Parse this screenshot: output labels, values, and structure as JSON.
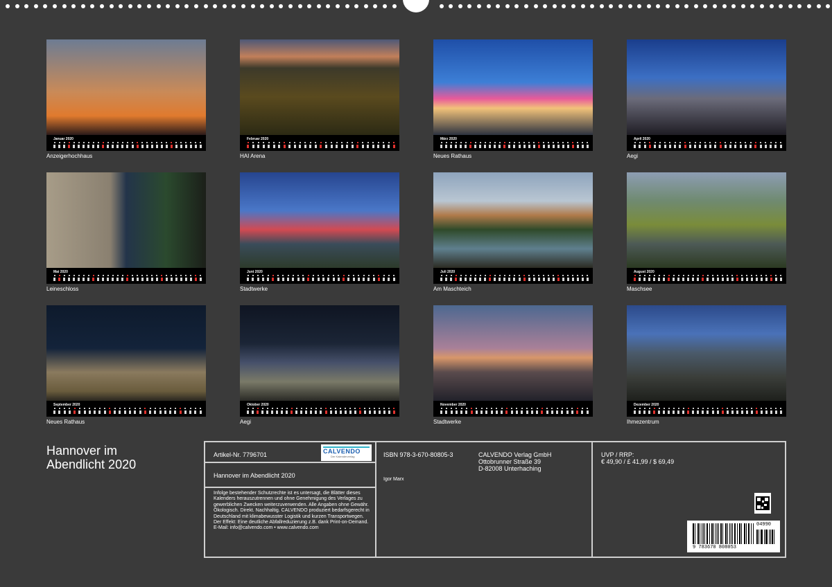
{
  "months": [
    {
      "name": "Januar 2020",
      "caption": "Anzeigerhochhaus",
      "start": 3,
      "days": 31
    },
    {
      "name": "Februar 2020",
      "caption": "HAI Arena",
      "start": 6,
      "days": 29
    },
    {
      "name": "März 2020",
      "caption": "Neues Rathaus",
      "start": 0,
      "days": 31
    },
    {
      "name": "April 2020",
      "caption": "Aegi",
      "start": 3,
      "days": 30
    },
    {
      "name": "Mai 2020",
      "caption": "Leineschloss",
      "start": 5,
      "days": 31
    },
    {
      "name": "Juni 2020",
      "caption": "Stadtwerke",
      "start": 1,
      "days": 30
    },
    {
      "name": "Juli 2020",
      "caption": "Am Maschteich",
      "start": 3,
      "days": 31
    },
    {
      "name": "August 2020",
      "caption": "Maschsee",
      "start": 6,
      "days": 31
    },
    {
      "name": "September 2020",
      "caption": "Neues Rathaus",
      "start": 2,
      "days": 30
    },
    {
      "name": "Oktober 2020",
      "caption": "Aegi",
      "start": 4,
      "days": 31
    },
    {
      "name": "November 2020",
      "caption": "Stadtwerke",
      "start": 0,
      "days": 30
    },
    {
      "name": "Dezember 2020",
      "caption": "Ihmezentrum",
      "start": 2,
      "days": 31
    }
  ],
  "cover": {
    "title_line1": "Hannover im",
    "title_line2": "Abendlicht 2020"
  },
  "info": {
    "article": "Artikel-Nr. 7796701",
    "logo": "CALVENDO",
    "logo_sub": "Der Kalenderverlag",
    "calendar_title": "Hannover im Abendlicht 2020",
    "legal": "Infolge bestehender Schutzrechte ist es untersagt, die Blätter dieses Kalenders herauszutrennen und ohne Genehmigung des Verlages zu gewerblichen Zwecken weiterzuverwenden. Alle Angaben ohne Gewähr.\nÖkologisch. Direkt. Nachhaltig. CALVENDO produziert bedarfsgerecht in Deutschland mit klimabewusster Logistik und kurzen Transportwegen. Der Effekt: Eine deutliche Abfallreduzierung z.B. dank Print-on-Demand.\nE-Mail: info@calvendo.com • www.calvendo.com",
    "isbn": "ISBN 978-3-670-80805-3",
    "author": "Igor Marx",
    "publisher1": "CALVENDO Verlag GmbH",
    "publisher2": "Ottobrunner Straße 39",
    "publisher3": "D-82008 Unterhaching",
    "price_label": "UVP / RRP:",
    "price": "€ 49,90 / £ 41,99 / $ 69,49",
    "barcode_number": "9 783670 808053",
    "barcode_addon": "04990"
  },
  "colors": {
    "background": "#3a3a3a",
    "sunday": "#e0322e",
    "frame": "#d0d0d0"
  }
}
